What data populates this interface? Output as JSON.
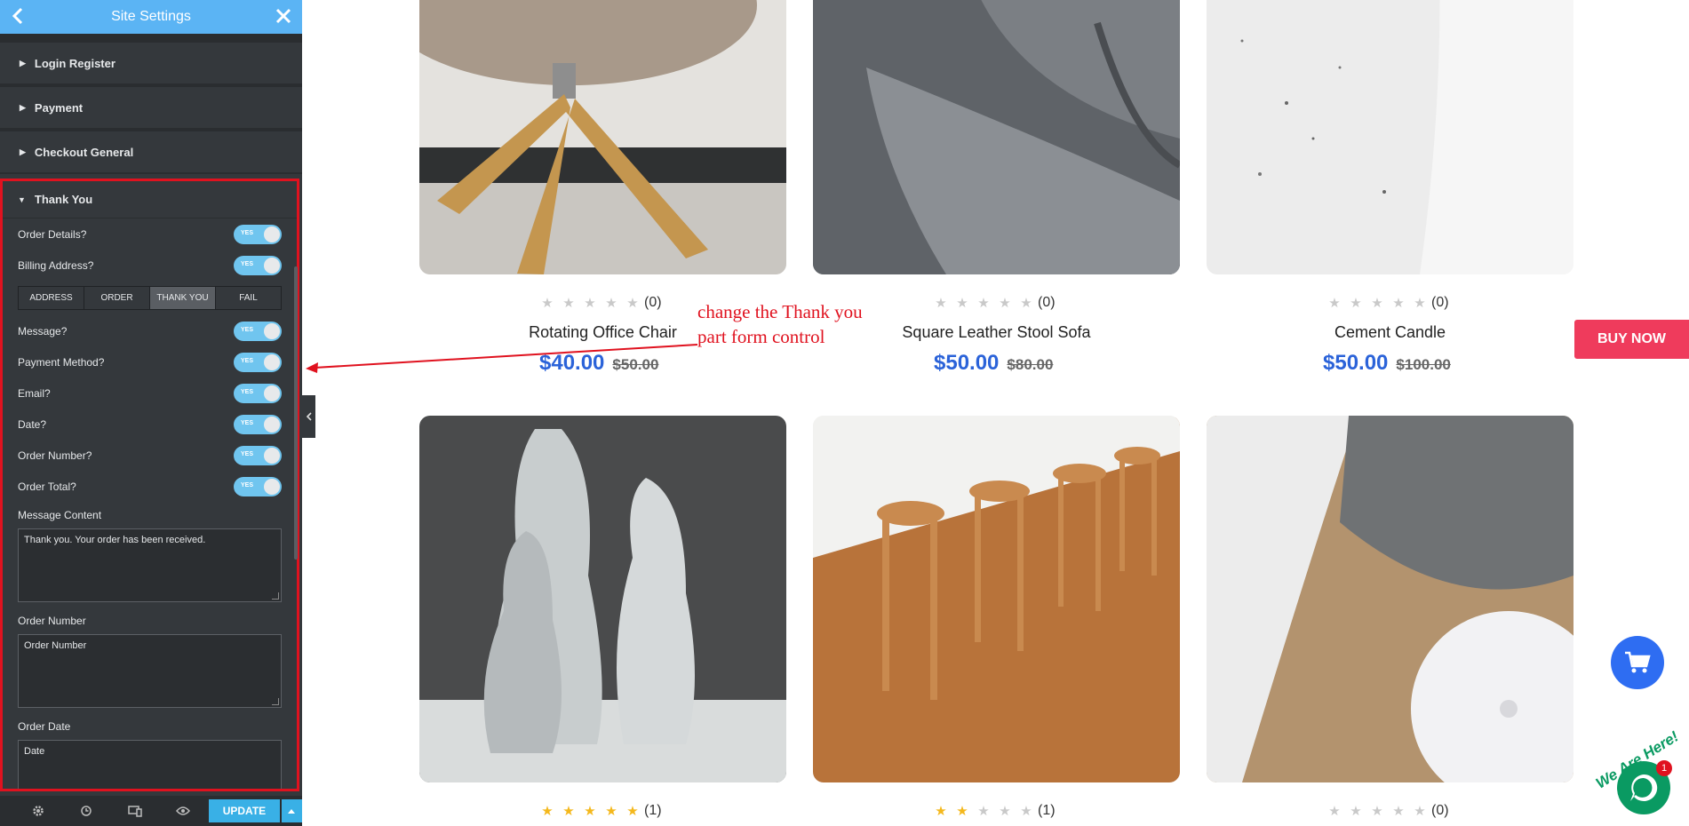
{
  "panel": {
    "title": "Site Settings",
    "sections": [
      "Login Register",
      "Payment",
      "Checkout General"
    ],
    "thank_you": {
      "title": "Thank You",
      "toggles_top": [
        {
          "label": "Order Details?",
          "state": "YES"
        },
        {
          "label": "Billing Address?",
          "state": "YES"
        }
      ],
      "tabs": [
        "ADDRESS",
        "ORDER",
        "THANK YOU",
        "FAIL"
      ],
      "active_tab": "THANK YOU",
      "toggles": [
        {
          "label": "Message?",
          "state": "YES"
        },
        {
          "label": "Payment Method?",
          "state": "YES"
        },
        {
          "label": "Email?",
          "state": "YES"
        },
        {
          "label": "Date?",
          "state": "YES"
        },
        {
          "label": "Order Number?",
          "state": "YES"
        },
        {
          "label": "Order Total?",
          "state": "YES"
        }
      ],
      "fields": [
        {
          "label": "Message Content",
          "value": "Thank you. Your order has been received."
        },
        {
          "label": "Order Number",
          "value": "Order Number"
        },
        {
          "label": "Order Date",
          "value": "Date"
        }
      ]
    },
    "footer": {
      "update_label": "UPDATE",
      "icons": [
        "gear-icon",
        "history-icon",
        "responsive-icon",
        "eye-icon"
      ]
    }
  },
  "annotation": {
    "line1": "change the Thank you",
    "line2": "part form control",
    "color": "#e0121f"
  },
  "products": [
    {
      "name": "Rotating Office Chair",
      "price": "$40.00",
      "old_price": "$50.00",
      "rating": 0,
      "reviews": "(0)"
    },
    {
      "name": "Square Leather Stool Sofa",
      "price": "$50.00",
      "old_price": "$80.00",
      "rating": 0,
      "reviews": "(0)"
    },
    {
      "name": "Cement Candle",
      "price": "$50.00",
      "old_price": "$100.00",
      "rating": 0,
      "reviews": "(0)"
    },
    {
      "rating": 5,
      "reviews": "(1)"
    },
    {
      "rating": 2,
      "reviews": "(1)"
    },
    {
      "rating": 0,
      "reviews": "(0)"
    }
  ],
  "buy_now": "BUY NOW",
  "chat": {
    "caption": "We Are Here!",
    "badge": "1"
  },
  "colors": {
    "accent": "#5bb4f4",
    "price": "#2b63d9",
    "buy_now": "#ef3b5c",
    "highlight": "#e0121f"
  }
}
